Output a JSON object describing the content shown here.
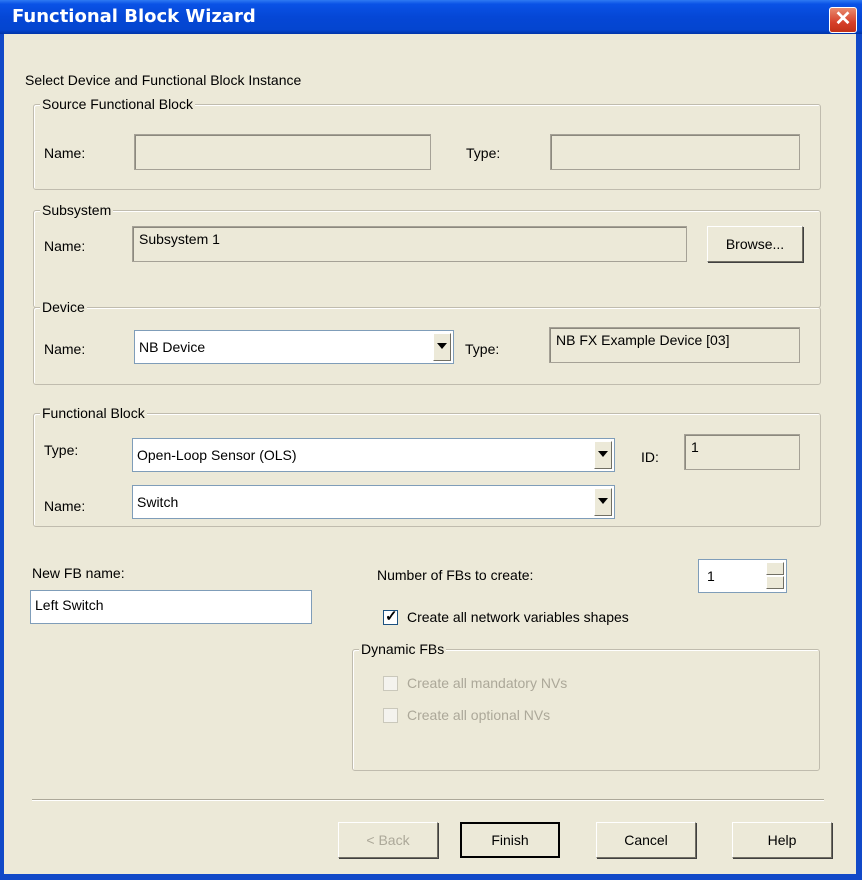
{
  "window": {
    "title": "Functional Block Wizard",
    "close_glyph": "✕"
  },
  "header": {
    "instruction": "Select Device and Functional Block Instance"
  },
  "source": {
    "group_title": "Source Functional Block",
    "name_label": "Name:",
    "name_value": "",
    "type_label": "Type:",
    "type_value": ""
  },
  "subsystem": {
    "group_title": "Subsystem",
    "name_label": "Name:",
    "name_value": "Subsystem 1",
    "browse_label": "Browse..."
  },
  "device": {
    "group_title": "Device",
    "name_label": "Name:",
    "name_value": "NB Device",
    "type_label": "Type:",
    "type_value": "NB FX Example Device [03]"
  },
  "fb": {
    "group_title": "Functional Block",
    "type_label": "Type:",
    "type_value": "Open-Loop Sensor (OLS)",
    "id_label": "ID:",
    "id_value": "1",
    "name_label": "Name:",
    "name_value": "Switch"
  },
  "new_fb": {
    "label": "New FB name:",
    "value": "Left Switch"
  },
  "count": {
    "label": "Number of FBs to create:",
    "value": "1"
  },
  "create_shapes": {
    "label": "Create all network variables shapes",
    "checked": true
  },
  "dynamic": {
    "group_title": "Dynamic FBs",
    "mandatory_label": "Create all mandatory NVs",
    "optional_label": "Create all optional NVs"
  },
  "buttons": {
    "back": "< Back",
    "finish": "Finish",
    "cancel": "Cancel",
    "help": "Help"
  }
}
